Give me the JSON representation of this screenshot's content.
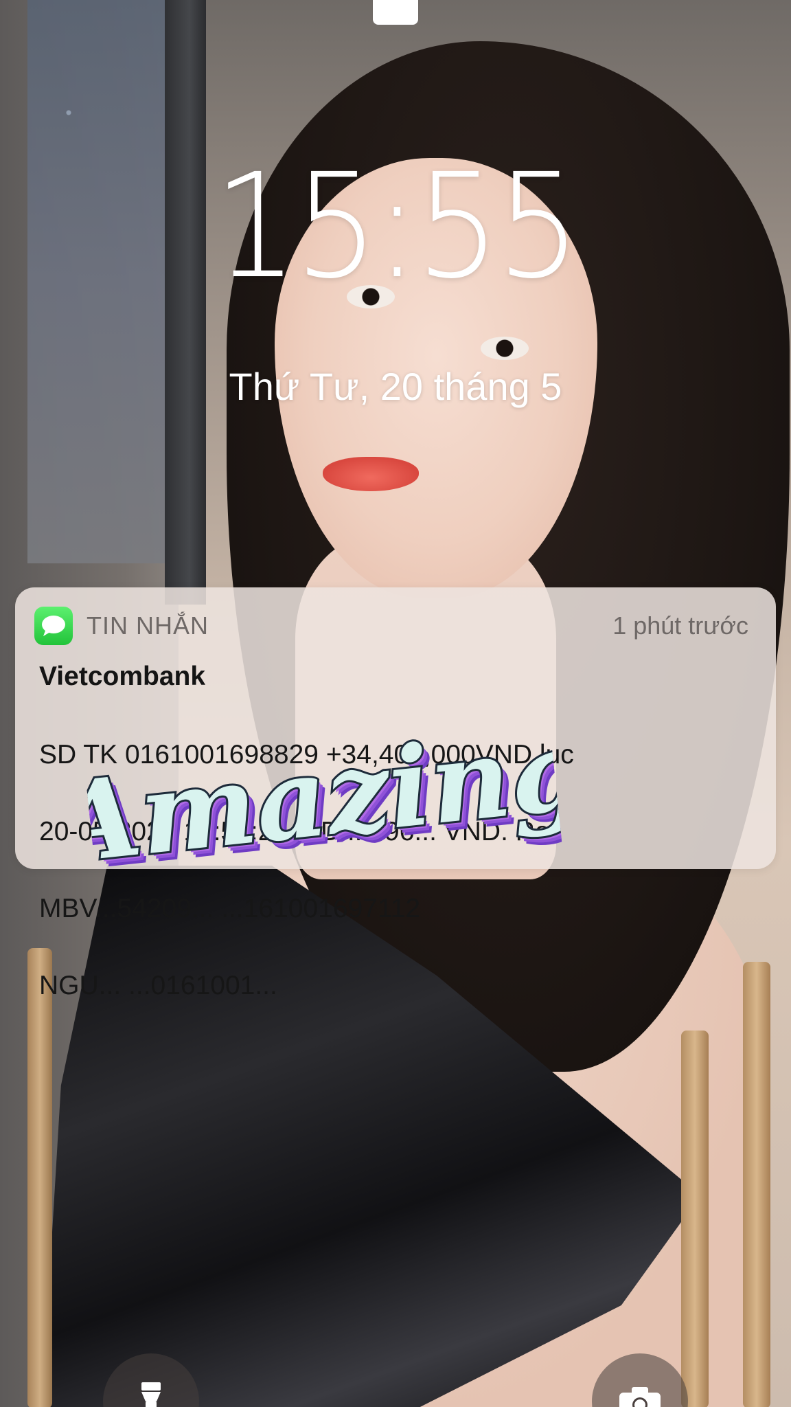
{
  "lock_screen": {
    "time": "15:55",
    "date": "Thứ Tư, 20 tháng 5"
  },
  "notification": {
    "app_name": "TIN NHẮN",
    "time_ago": "1 phút trước",
    "title": "Vietcombank",
    "body_lines": [
      "SD TK 0161001698829 +34,400,000VND luc",
      "20-05-2020 15:54:26. SD ...896... VND. Ref",
      "MBV...54209...                  ...161001697112",
      "NGU...                       ...0161001..."
    ]
  },
  "sticker": {
    "text": "Amazing"
  },
  "bottom_controls": {
    "flashlight_icon": "flashlight-icon",
    "camera_icon": "camera-icon"
  },
  "colors": {
    "message_icon_green": "#22c33a",
    "notification_bg": "#eee4e0",
    "sticker_fill": "#d9f3ef",
    "sticker_shadow": "#a65bd8"
  }
}
